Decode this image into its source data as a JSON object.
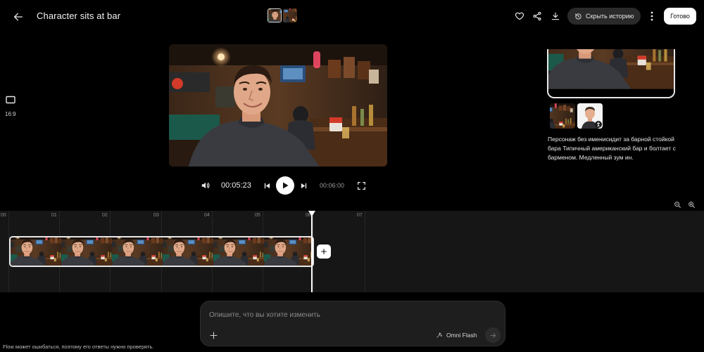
{
  "header": {
    "title": "Character sits at bar",
    "history_label": "Скрыть историю",
    "done_label": "Готово"
  },
  "aspect": {
    "label": "16:9"
  },
  "player": {
    "current_time": "00:05:23",
    "total_time": "00:06:00"
  },
  "reference": {
    "description": "Персонаж без именисидит за барной стойкой бара Типичный американский бар и болтает с барменом. Медленный зум ин."
  },
  "timeline": {
    "ruler": [
      "00",
      "01",
      "02",
      "03",
      "04",
      "05",
      "06",
      "07"
    ]
  },
  "prompt": {
    "placeholder": "Опишите, что вы хотите изменить",
    "model_label": "Omni Flash"
  },
  "footer": {
    "disclaimer": "Flow может ошибаться, поэтому его ответы нужно проверять."
  },
  "colors": {
    "background": "#000000",
    "timeline": "#161616",
    "accent": "#ffffff"
  },
  "icons": [
    "back-arrow-icon",
    "heart-icon",
    "share-icon",
    "download-icon",
    "history-icon",
    "more-vert-icon",
    "aspect-ratio-icon",
    "volume-icon",
    "skip-previous-icon",
    "play-icon",
    "skip-next-icon",
    "fullscreen-icon",
    "zoom-out-icon",
    "zoom-in-icon",
    "plus-icon",
    "sparkle-icon",
    "send-arrow-icon"
  ]
}
